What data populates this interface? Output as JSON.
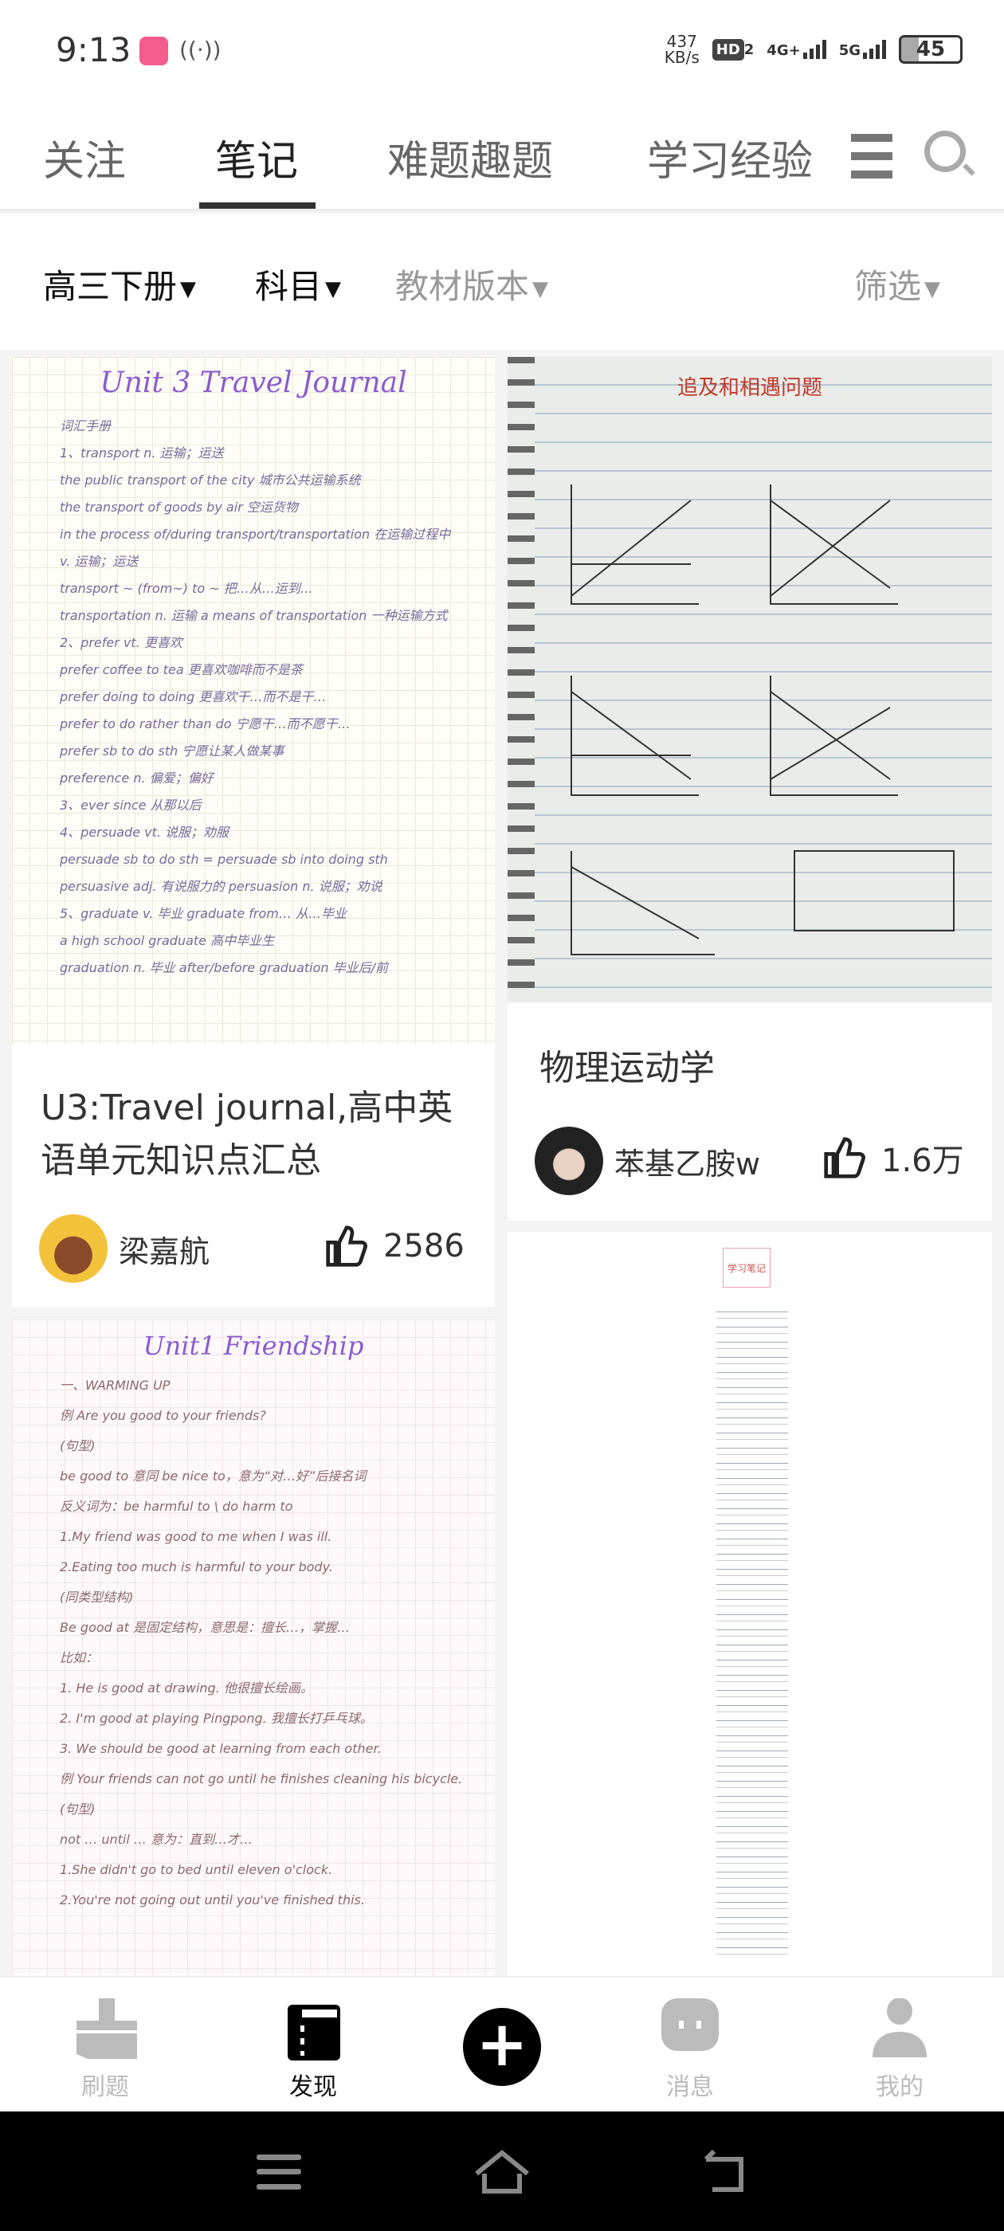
{
  "status": {
    "time": "9:13",
    "speed_value": "437",
    "speed_unit": "KB/s",
    "hd": "HD",
    "hd_sub": "2",
    "net1": "4G+",
    "net2": "5G",
    "battery": "45",
    "app_icon": "bilibili-icon",
    "nfc_icon": "nfc-icon"
  },
  "tabs": [
    {
      "label": "关注"
    },
    {
      "label": "笔记",
      "active": true
    },
    {
      "label": "难题趣题"
    },
    {
      "label": "学习经验"
    }
  ],
  "filters": {
    "grade": "高三下册",
    "subject": "科目",
    "edition": "教材版本",
    "filter": "筛选"
  },
  "cards": [
    {
      "title": "U3:Travel journal,高中英语单元知识点汇总",
      "author": "梁嘉航",
      "likes": "2586",
      "image_heading": "Unit 3  Travel Journal",
      "image_lines": [
        "词汇手册",
        "1、transport n. 运输；运送",
        "the public transport of the city 城市公共运输系统",
        "the transport of goods by air 空运货物",
        "in the process of/during transport/transportation 在运输过程中",
        "v. 运输；运送",
        "transport ~ (from~) to ~ 把…从…运到…",
        "transportation n. 运输 a means of transportation 一种运输方式",
        "2、prefer vt. 更喜欢",
        "prefer coffee to tea 更喜欢咖啡而不是茶",
        "prefer doing to doing 更喜欢干…而不是干…",
        "prefer to do rather than do 宁愿干…而不愿干…",
        "prefer sb to do sth 宁愿让某人做某事",
        "preference n. 偏爱；偏好",
        "3、ever since 从那以后",
        "4、persuade vt. 说服；劝服",
        "persuade sb to do sth = persuade sb into doing sth",
        "persuasive adj. 有说服力的  persuasion n. 说服；劝说",
        "5、graduate v. 毕业  graduate from… 从…毕业",
        "a high school graduate 高中毕业生",
        "graduation n. 毕业  after/before graduation 毕业后/前"
      ]
    },
    {
      "title": "物理运动学",
      "author": "苯基乙胺w",
      "likes": "1.6万",
      "image_heading": "追及和相遇问题"
    },
    {
      "image_heading": "Unit1 Friendship",
      "image_lines": [
        "一、WARMING UP",
        "例 Are you good to your friends?",
        "(句型)",
        "be good to 意同 be nice to，意为“对…好”后接名词",
        "反义词为：be harmful to \\ do harm to",
        "1.My friend was good to me when I was ill.",
        "2.Eating too much is harmful to your body.",
        "(同类型结构)",
        "Be good at 是固定结构，意思是：擅长…，掌握…",
        "比如：",
        "1. He is good at drawing. 他很擅长绘画。",
        "2. I'm good at playing Pingpong. 我擅长打乒乓球。",
        "3. We should be good at learning from each other.",
        "例 Your friends can not go until he finishes cleaning his bicycle.",
        "(句型)",
        "not … until … 意为：直到…才…",
        "1.She didn't go to bed until eleven o'clock.",
        "2.You're not going out until you've finished this."
      ]
    },
    {
      "image_heading": "学习笔记"
    }
  ],
  "bottom_nav": [
    {
      "label": "刷题",
      "icon": "broom-icon"
    },
    {
      "label": "发现",
      "icon": "notebook-icon",
      "active": true
    },
    {
      "label": "",
      "icon": "plus-icon"
    },
    {
      "label": "消息",
      "icon": "message-icon"
    },
    {
      "label": "我的",
      "icon": "user-icon"
    }
  ],
  "colors": {
    "accent": "#222222",
    "inactive": "#bbbbbb",
    "background": "#f4f4f4"
  }
}
